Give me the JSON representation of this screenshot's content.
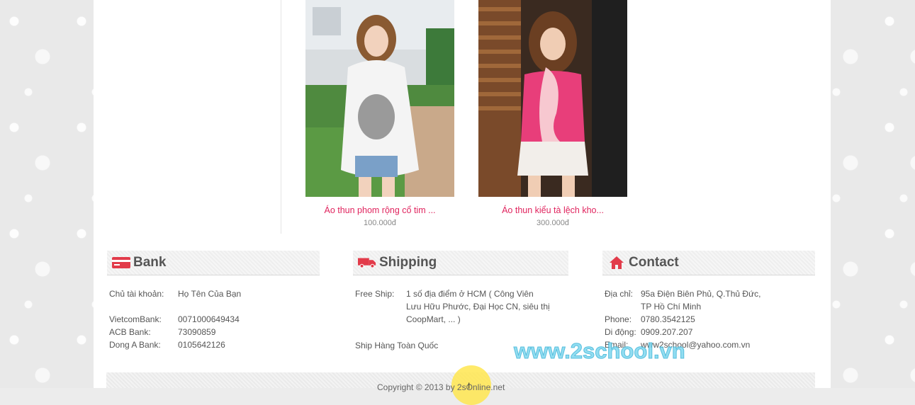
{
  "products": [
    {
      "name": "Áo thun phom rộng cổ tim ...",
      "price": "100.000đ"
    },
    {
      "name": "Áo thun kiểu tà lệch kho...",
      "price": "300.000đ"
    }
  ],
  "bank": {
    "title": "Bank",
    "holder_label": "Chủ tài khoản:",
    "holder_value": "Họ Tên Của Bạn",
    "accounts": [
      {
        "label": "VietcomBank:",
        "value": "0071000649434"
      },
      {
        "label": "ACB Bank:",
        "value": "73090859"
      },
      {
        "label": "Dong A Bank:",
        "value": "0105642126"
      }
    ]
  },
  "shipping": {
    "title": "Shipping",
    "free_label": "Free Ship:",
    "free_lines": [
      "1 số địa điểm ở HCM ( Công Viên",
      "Lưu Hữu Phước, Đại Học CN, siêu thị",
      "CoopMart, ... )"
    ],
    "nationwide": "Ship Hàng Toàn Quốc"
  },
  "contact": {
    "title": "Contact",
    "address_label": "Địa chỉ:",
    "address_lines": [
      "95a Điện Biên Phủ, Q.Thủ Đức,",
      "TP Hồ Chí Minh"
    ],
    "phone_label": "Phone:",
    "phone": "0780.3542125",
    "mobile_label": "Di động:",
    "mobile": "0909.207.207",
    "email_label": "Email:",
    "email": "www2school@yahoo.com.vn"
  },
  "footer": {
    "copyright": "Copyright © 2013 by 2sOnline.net"
  },
  "watermark": "www.2school.vn",
  "icons": {
    "bank": "credit-card-icon",
    "shipping": "truck-icon",
    "contact": "home-icon"
  },
  "colors": {
    "accent": "#e0245e",
    "icon_red": "#e23b4a"
  }
}
